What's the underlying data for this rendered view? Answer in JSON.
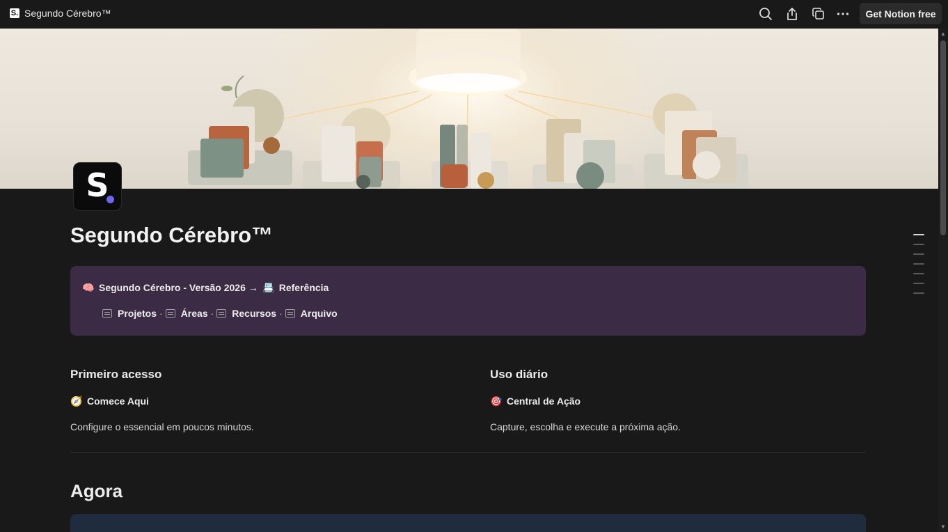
{
  "window": {
    "favicon_letter": "S.",
    "title": "Segundo Cérebro™",
    "toolbar": {
      "search_icon": "search-icon",
      "share_icon": "share-icon",
      "duplicate_icon": "duplicate-icon",
      "more_icon": "more-horizontal-icon",
      "cta_label": "Get Notion free"
    }
  },
  "page": {
    "icon_letter": "S",
    "icon_dot_color": "#6f66f0",
    "title": "Segundo Cérebro™",
    "callout": {
      "background": "#3b2b45",
      "line1_emoji": "🧠",
      "line1_text": "Segundo Cérebro - Versão 2026 →",
      "line1_link_emoji": "📇",
      "line1_link": "Referência",
      "links": [
        {
          "label": "Projetos"
        },
        {
          "label": "Áreas"
        },
        {
          "label": "Recursos"
        },
        {
          "label": "Arquivo"
        }
      ],
      "separator": "·"
    },
    "columns": [
      {
        "heading": "Primeiro acesso",
        "link_emoji": "🧭",
        "link": "Comece Aqui",
        "description": "Configure o essencial em poucos minutos."
      },
      {
        "heading": "Uso diário",
        "link_emoji": "🎯",
        "link": "Central de Ação",
        "description": "Capture, escolha e execute a próxima ação."
      }
    ],
    "section": {
      "title": "Agora"
    }
  }
}
